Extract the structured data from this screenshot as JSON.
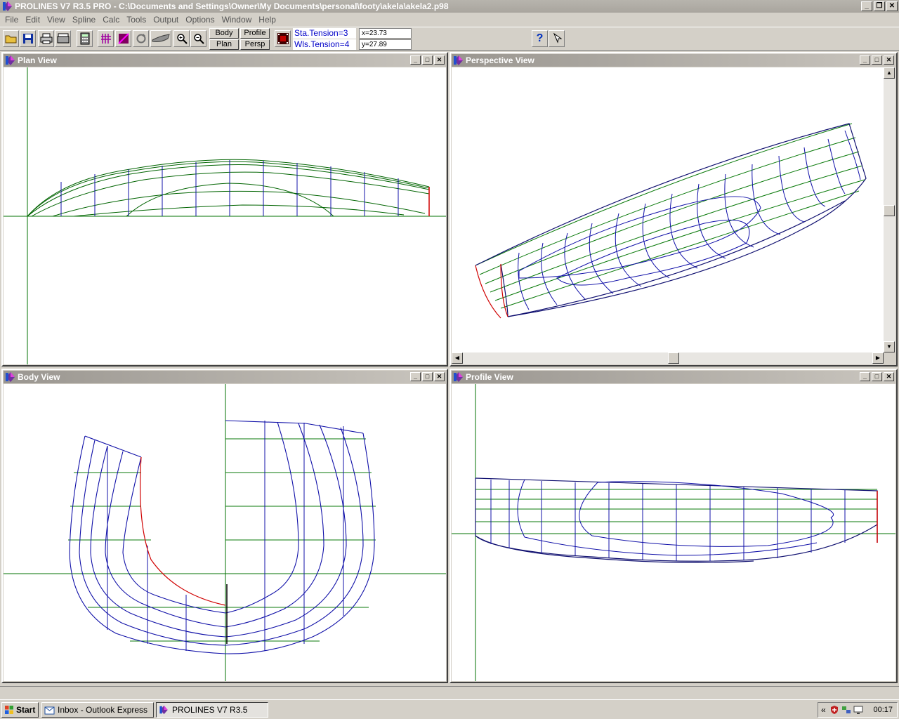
{
  "window": {
    "title": "PROLINES V7 R3.5 PRO - C:\\Documents and Settings\\Owner\\My Documents\\personal\\footy\\akela\\akela2.p98",
    "minimize": "_",
    "restore": "❐",
    "close": "✕"
  },
  "menu": [
    "File",
    "Edit",
    "View",
    "Spline",
    "Calc",
    "Tools",
    "Output",
    "Options",
    "Window",
    "Help"
  ],
  "toolbar": {
    "body_label": "Body",
    "profile_label": "Profile",
    "plan_label": "Plan",
    "persp_label": "Persp",
    "sta_tension": "Sta.Tension=3",
    "wls_tension": "Wls.Tension=4",
    "x_coord": "x=23.73",
    "y_coord": "y=27.89",
    "help_icon": "?"
  },
  "views": {
    "plan": "Plan View",
    "perspective": "Perspective View",
    "body": "Body View",
    "profile": "Profile View"
  },
  "colors": {
    "station": "#1010a8",
    "waterline": "#0a7a0a",
    "sheer": "#006400",
    "highlight": "#d00000",
    "axis": "#007000"
  },
  "taskbar": {
    "start": "Start",
    "task1": "Inbox - Outlook Express",
    "task2": "PROLINES V7 R3.5",
    "tray_chevron": "«",
    "clock": "00:17"
  }
}
